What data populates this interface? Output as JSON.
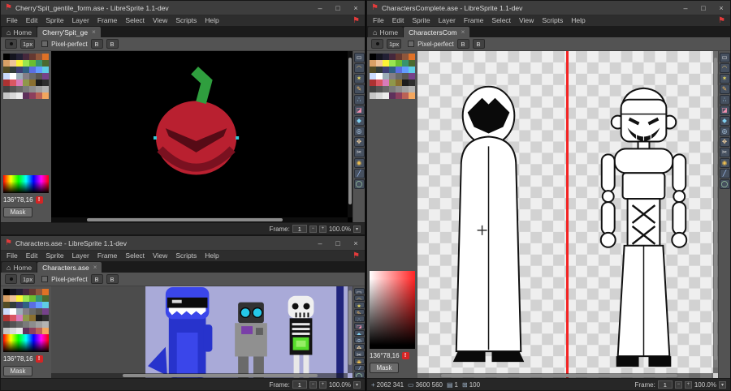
{
  "shared": {
    "menu": [
      "File",
      "Edit",
      "Sprite",
      "Layer",
      "Frame",
      "Select",
      "View",
      "Scripts",
      "Help"
    ],
    "home_tab": "Home",
    "brush_button": "1px",
    "pixel_perfect": "Pixel-perfect",
    "ink_button_1": "B",
    "ink_button_2": "B",
    "hsv_readout": "136°78,16",
    "mask_button": "Mask",
    "frame_label": "Frame:"
  },
  "icons": {
    "logo": "⚑",
    "home": "⌂",
    "minimize": "–",
    "maximize": "□",
    "close": "×",
    "warning": "!",
    "pos": "+",
    "size": "▭",
    "frames": "▤",
    "opacity": "⊞",
    "spin_minus": "−",
    "spin_plus": "+",
    "zoom_menu": "▾"
  },
  "palette": [
    "#000000",
    "#14141e",
    "#222034",
    "#45283c",
    "#663931",
    "#8f563b",
    "#df7126",
    "#d9a066",
    "#eec39a",
    "#fbf236",
    "#99e550",
    "#6abe30",
    "#37946e",
    "#4b692f",
    "#524b24",
    "#323c39",
    "#3f3f74",
    "#306082",
    "#5b6ee1",
    "#639bff",
    "#5fcde4",
    "#cbdbfc",
    "#ffffff",
    "#9badb7",
    "#847e87",
    "#696a6a",
    "#595652",
    "#76428a",
    "#ac3232",
    "#d95763",
    "#d77bba",
    "#8f974a",
    "#8a6f30",
    "#1c1c1c",
    "#2e2e2e",
    "#414141",
    "#545454",
    "#676767",
    "#7a7a7a",
    "#8d8d8d",
    "#a0a0a0",
    "#b3b3b3",
    "#c6c6c6",
    "#d9d9d9",
    "#ececec",
    "#5e315b",
    "#8c3f5d",
    "#ba6156",
    "#f2a65e"
  ],
  "tools": [
    {
      "name": "rectangular-marquee",
      "glyph": "▭",
      "color": "#d8d8d8"
    },
    {
      "name": "lasso",
      "glyph": "◠",
      "color": "#e0c070"
    },
    {
      "name": "magic-wand",
      "glyph": "✶",
      "color": "#f0e060"
    },
    {
      "name": "pencil",
      "glyph": "✎",
      "color": "#f0b860"
    },
    {
      "name": "spray",
      "glyph": "∴",
      "color": "#a0d0f0"
    },
    {
      "name": "eraser",
      "glyph": "◪",
      "color": "#f090b0"
    },
    {
      "name": "eyedropper",
      "glyph": "◆",
      "color": "#80d0f0"
    },
    {
      "name": "zoom",
      "glyph": "◎",
      "color": "#c0e0ff"
    },
    {
      "name": "hand",
      "glyph": "✥",
      "color": "#f0d0a0"
    },
    {
      "name": "slice",
      "glyph": "✂",
      "color": "#e0e0e0"
    },
    {
      "name": "paint-bucket",
      "glyph": "◉",
      "color": "#f0c050"
    },
    {
      "name": "line",
      "glyph": "╱",
      "color": "#a8c8ff"
    },
    {
      "name": "ellipse",
      "glyph": "◯",
      "color": "#b0e8b0"
    }
  ],
  "windows": {
    "cherry": {
      "title": "Cherry'Spit_gentile_form.ase - LibreSprite 1.1-dev",
      "tab": "Cherry'Spit_ge",
      "status": {
        "frame": "1",
        "zoom": "100.0%"
      }
    },
    "characters": {
      "title": "Characters.ase - LibreSprite 1.1-dev",
      "tab": "Characters.ase",
      "status": {
        "frame": "1",
        "zoom": "100.0%"
      }
    },
    "complete": {
      "title": "CharactersComplete.ase - LibreSprite 1.1-dev",
      "tab": "CharactersCom",
      "status": {
        "frame": "1",
        "zoom": "100.0%",
        "cursor_pos": "2062 341",
        "sprite_size": "3600 560",
        "frame_count": "1",
        "opacity": "100"
      }
    }
  },
  "colors": {
    "accent_red": "#e23b3b",
    "panel_gray": "#535353",
    "cherry_red": "#b92030",
    "stem_green": "#2f9e3e",
    "sprite_lavender": "#a9aad8",
    "guide_red": "#f32424"
  }
}
